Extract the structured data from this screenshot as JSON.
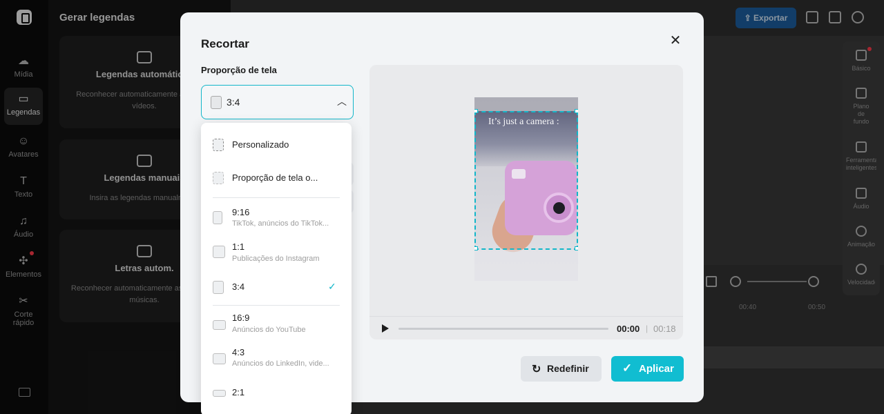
{
  "left_rail": {
    "items": [
      {
        "label": "Mídia",
        "icon": "cloud-upload-icon"
      },
      {
        "label": "Legendas",
        "icon": "captions-icon",
        "active": true
      },
      {
        "label": "Avatares",
        "icon": "avatar-icon"
      },
      {
        "label": "Texto",
        "icon": "text-icon"
      },
      {
        "label": "Áudio",
        "icon": "music-note-icon"
      },
      {
        "label": "Elementos",
        "icon": "elements-icon"
      },
      {
        "label": "Corte rápido",
        "icon": "quick-cut-icon"
      }
    ],
    "keyboard_icon": "keyboard-icon"
  },
  "caption_panel": {
    "title": "Gerar legendas",
    "cards": [
      {
        "title": "Legendas automáticas",
        "desc": "Reconhecer automaticamente a fala nos vídeos."
      },
      {
        "title": "Legendas manuais",
        "desc": "Insira as legendas manualmente"
      },
      {
        "title": "Letras autom.",
        "desc": "Reconhecer automaticamente as letras das músicas."
      }
    ]
  },
  "topbar": {
    "export_label": "Exportar"
  },
  "right_rail": {
    "items": [
      {
        "label": "Básico",
        "icon": "film-icon"
      },
      {
        "label": "Plano de fundo",
        "icon": "background-icon"
      },
      {
        "label": "Ferramentas inteligentes",
        "icon": "magic-wand-icon"
      },
      {
        "label": "Áudio",
        "icon": "music-note-icon"
      },
      {
        "label": "Animação",
        "icon": "animation-icon"
      },
      {
        "label": "Velocidade",
        "icon": "speed-icon"
      }
    ]
  },
  "timeline": {
    "ticks": [
      "00:40",
      "00:50"
    ]
  },
  "modal": {
    "title": "Recortar",
    "section_label": "Proporção de tela",
    "selected_ratio": "3:4",
    "dropdown": [
      {
        "label": "Personalizado",
        "sub": ""
      },
      {
        "label": "Proporção de tela o...",
        "sub": ""
      },
      {
        "label": "9:16",
        "sub": "TikTok, anúncios do TikTok..."
      },
      {
        "label": "1:1",
        "sub": "Publicações do Instagram"
      },
      {
        "label": "3:4",
        "sub": "",
        "selected": true
      },
      {
        "label": "16:9",
        "sub": "Anúncios do YouTube"
      },
      {
        "label": "4:3",
        "sub": "Anúncios do LinkedIn, vide..."
      },
      {
        "label": "2:1",
        "sub": ""
      }
    ],
    "preview": {
      "overlay_text": "It’s just a camera :"
    },
    "player": {
      "current": "00:00",
      "separator": "|",
      "total": "00:18"
    },
    "reset_label": "Redefinir",
    "apply_label": "Aplicar",
    "accent_color": "#11b6c9"
  }
}
